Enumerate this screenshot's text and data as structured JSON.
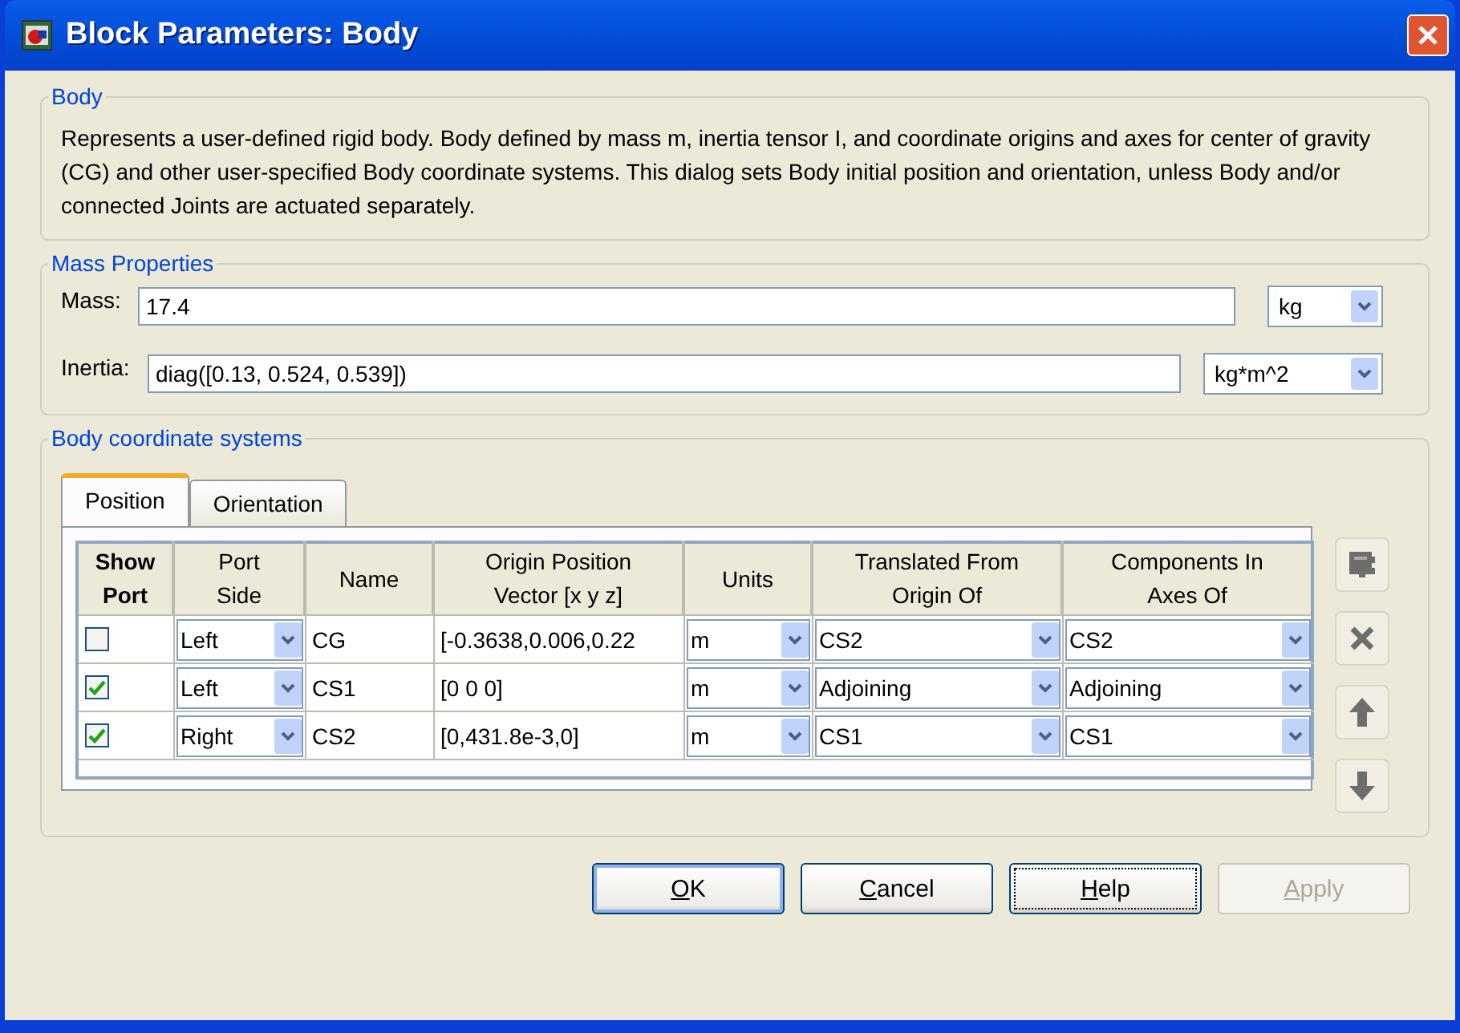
{
  "window": {
    "title": "Block Parameters: Body"
  },
  "body_group": {
    "title": "Body",
    "description": "Represents a user-defined rigid body. Body defined by mass m, inertia tensor I, and coordinate origins and axes for center of gravity (CG) and other user-specified Body coordinate systems. This dialog sets Body initial position and orientation, unless Body and/or connected Joints are actuated separately."
  },
  "mass_properties": {
    "title": "Mass Properties",
    "fields": [
      {
        "label": "Mass:",
        "value": "17.4",
        "unit": "kg"
      },
      {
        "label": "Inertia:",
        "value": "diag([0.13, 0.524, 0.539])",
        "unit": "kg*m^2"
      }
    ]
  },
  "coordinate_systems": {
    "title": "Body coordinate systems",
    "tabs": [
      {
        "label": "Position",
        "selected": true
      },
      {
        "label": "Orientation",
        "selected": false
      }
    ],
    "columns": [
      "Show\nPort",
      "Port\nSide",
      "Name",
      "Origin Position\nVector [x y z]",
      "Units",
      "Translated From\nOrigin Of",
      "Components In\nAxes Of"
    ],
    "rows": [
      {
        "show_port": false,
        "port_side": "Left",
        "name": "CG",
        "origin": "[-0.3638,0.006,0.22",
        "units": "m",
        "translated_from": "CS2",
        "components_in": "CS2"
      },
      {
        "show_port": true,
        "port_side": "Left",
        "name": "CS1",
        "origin": "[0 0 0]",
        "units": "m",
        "translated_from": "Adjoining",
        "components_in": "Adjoining"
      },
      {
        "show_port": true,
        "port_side": "Right",
        "name": "CS2",
        "origin": "[0,431.8e-3,0]",
        "units": "m",
        "translated_from": "CS1",
        "components_in": "CS1"
      }
    ]
  },
  "buttons": [
    {
      "label": "OK",
      "disabled": false,
      "focused": false,
      "default": true
    },
    {
      "label": "Cancel",
      "disabled": false,
      "focused": false,
      "default": false
    },
    {
      "label": "Help",
      "disabled": false,
      "focused": true,
      "default": false
    },
    {
      "label": "Apply",
      "disabled": true,
      "focused": false,
      "default": false
    }
  ]
}
